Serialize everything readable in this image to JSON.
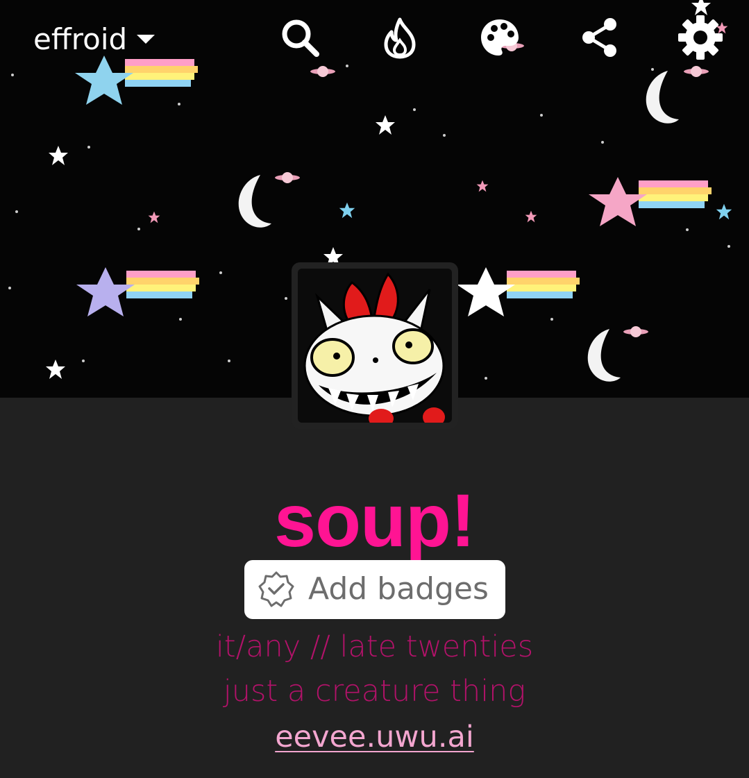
{
  "topbar": {
    "blog_name": "effroid",
    "icons": [
      "search-icon",
      "flame-icon",
      "palette-icon",
      "share-icon",
      "gear-icon"
    ]
  },
  "profile": {
    "title": "soup!",
    "badges_button_label": "Add badges",
    "description_lines": [
      "it/any // late twenties",
      "just a creature thing"
    ],
    "link_text": "eevee.uwu.ai"
  },
  "colors": {
    "title": "#ff1493",
    "description": "#b3126a",
    "link": "#f3a6cf",
    "page_background": "#212121",
    "header_background": "#050505"
  }
}
